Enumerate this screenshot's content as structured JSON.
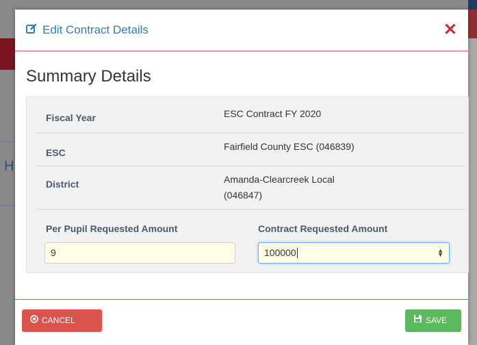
{
  "modal": {
    "title": "Edit Contract Details",
    "close_symbol": "✕",
    "section_title": "Summary Details"
  },
  "details": [
    {
      "label": "Fiscal Year",
      "value": "ESC Contract FY 2020"
    },
    {
      "label": "ESC",
      "value": "Fairfield County ESC (046839)"
    },
    {
      "label": "District",
      "value_line1": "Amanda-Clearcreek Local",
      "value_line2": "(046847)"
    }
  ],
  "fields": {
    "per_pupil": {
      "label": "Per Pupil Requested Amount",
      "value": "9"
    },
    "contract": {
      "label": "Contract Requested Amount",
      "value": "100000"
    }
  },
  "buttons": {
    "cancel": "CANCEL",
    "save": "SAVE"
  },
  "background": {
    "partial_letter": "H"
  },
  "colors": {
    "accent": "#337ab7",
    "danger": "#d9534f",
    "success": "#5cb85c",
    "input_bg": "#fefde6"
  },
  "icons": {
    "header": "edit-icon",
    "close": "close-icon",
    "cancel": "circle-x-icon",
    "save": "floppy-icon"
  }
}
